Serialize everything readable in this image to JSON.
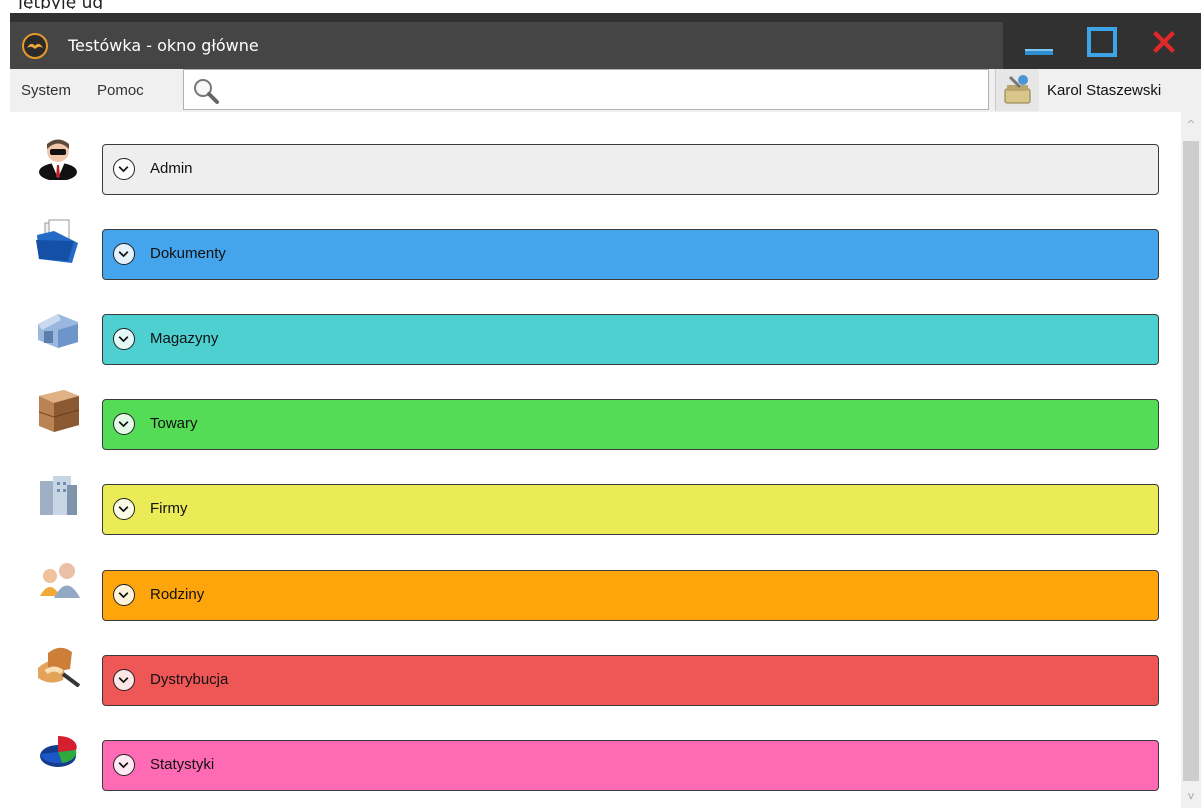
{
  "top_crop_text": "Jętpyję ug",
  "window": {
    "title": "Testówka - okno główne",
    "controls": [
      "minimize",
      "maximize",
      "close"
    ]
  },
  "menubar": {
    "items": [
      "System",
      "Pomoc"
    ],
    "search_value": "",
    "user_name": "Karol Staszewski"
  },
  "modules": [
    {
      "label": "Admin",
      "color": "#eeeeee",
      "icon": "admin-user-icon"
    },
    {
      "label": "Dokumenty",
      "color": "#45a5ec",
      "icon": "folder-documents-icon"
    },
    {
      "label": "Magazyny",
      "color": "#4dd0cf",
      "icon": "warehouse-icon"
    },
    {
      "label": "Towary",
      "color": "#55dc57",
      "icon": "boxes-pallet-icon"
    },
    {
      "label": "Firmy",
      "color": "#ebeb58",
      "icon": "office-buildings-icon"
    },
    {
      "label": "Rodziny",
      "color": "#ffa50c",
      "icon": "family-people-icon"
    },
    {
      "label": "Dystrybucja",
      "color": "#ef5757",
      "icon": "bread-knife-icon"
    },
    {
      "label": "Statystyki",
      "color": "#ff6ab5",
      "icon": "pie-chart-icon"
    }
  ]
}
